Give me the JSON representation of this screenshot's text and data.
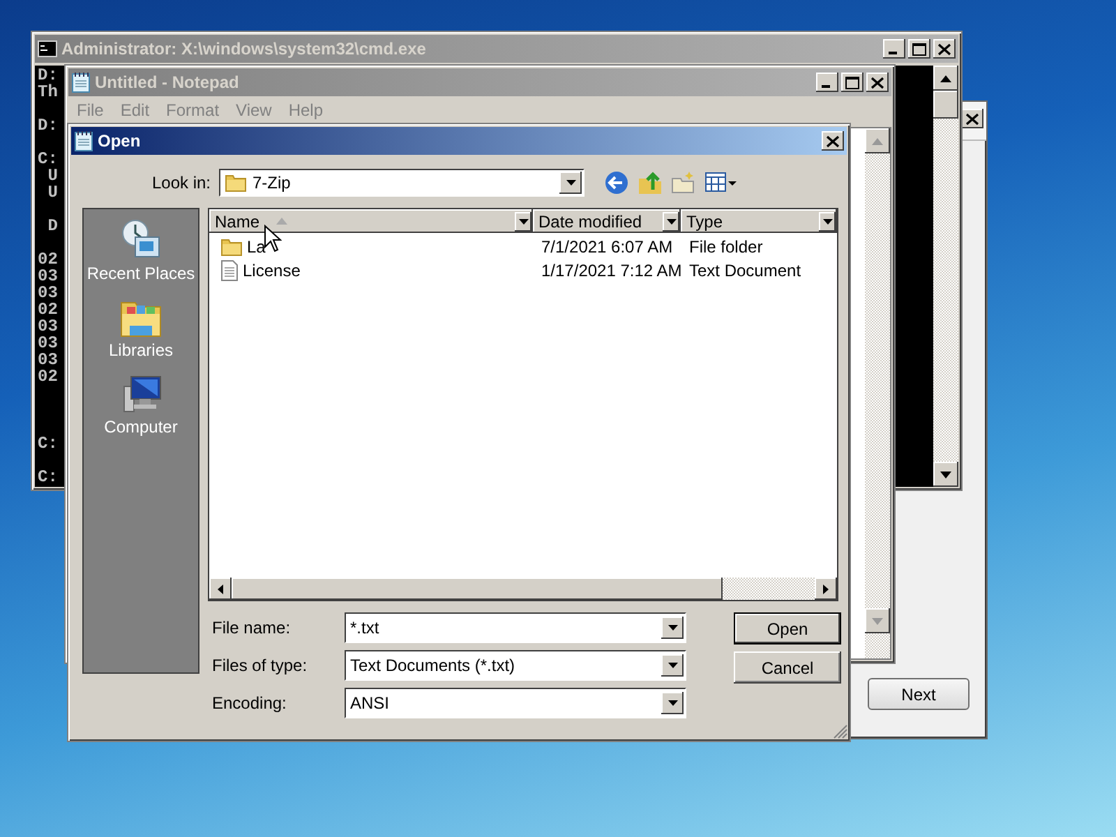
{
  "setup_window": {
    "next_button": "Next"
  },
  "console_window": {
    "title": "Administrator: X:\\windows\\system32\\cmd.exe",
    "lines": [
      {
        "kind": "text",
        "text": "D:"
      },
      {
        "kind": "text",
        "text": "Th"
      },
      {
        "kind": "blank"
      },
      {
        "kind": "text",
        "text": "D:"
      },
      {
        "kind": "blank"
      },
      {
        "kind": "text",
        "text": "C:"
      },
      {
        "kind": "text",
        "text": " U"
      },
      {
        "kind": "text",
        "text": " U"
      },
      {
        "kind": "blank"
      },
      {
        "kind": "text",
        "text": " D"
      },
      {
        "kind": "blank"
      },
      {
        "kind": "text",
        "text": "02"
      },
      {
        "kind": "text",
        "text": "03"
      },
      {
        "kind": "text",
        "text": "03"
      },
      {
        "kind": "text",
        "text": "02"
      },
      {
        "kind": "text",
        "text": "03"
      },
      {
        "kind": "text",
        "text": "03"
      },
      {
        "kind": "text",
        "text": "03"
      },
      {
        "kind": "text",
        "text": "02"
      },
      {
        "kind": "blank"
      },
      {
        "kind": "blank"
      },
      {
        "kind": "blank"
      },
      {
        "kind": "text",
        "text": "C:"
      },
      {
        "kind": "blank"
      },
      {
        "kind": "text",
        "text": "C:"
      }
    ]
  },
  "notepad_window": {
    "title": "Untitled - Notepad",
    "menu": [
      "File",
      "Edit",
      "Format",
      "View",
      "Help"
    ]
  },
  "open_dialog": {
    "title": "Open",
    "look_in": {
      "label": "Look in:",
      "value": "7-Zip"
    },
    "places": [
      {
        "kind": "recent",
        "label": "Recent Places"
      },
      {
        "kind": "libraries",
        "label": "Libraries"
      },
      {
        "kind": "computer",
        "label": "Computer"
      }
    ],
    "columns": [
      {
        "label": "Name",
        "sorted": true
      },
      {
        "label": "Date modified",
        "sorted": false
      },
      {
        "label": "Type",
        "sorted": false
      }
    ],
    "rows": [
      {
        "kind": "folder",
        "name": "La",
        "date": "7/1/2021 6:07 AM",
        "type": "File folder"
      },
      {
        "kind": "document",
        "name": "License",
        "date": "1/17/2021 7:12 AM",
        "type": "Text Document"
      }
    ],
    "fields": [
      {
        "label": "File name:",
        "value": "*.txt"
      },
      {
        "label": "Files of type:",
        "value": "Text Documents (*.txt)"
      },
      {
        "label": "Encoding:",
        "value": "ANSI"
      }
    ],
    "buttons": [
      {
        "label": "Open",
        "default": true
      },
      {
        "label": "Cancel",
        "default": false
      }
    ]
  }
}
